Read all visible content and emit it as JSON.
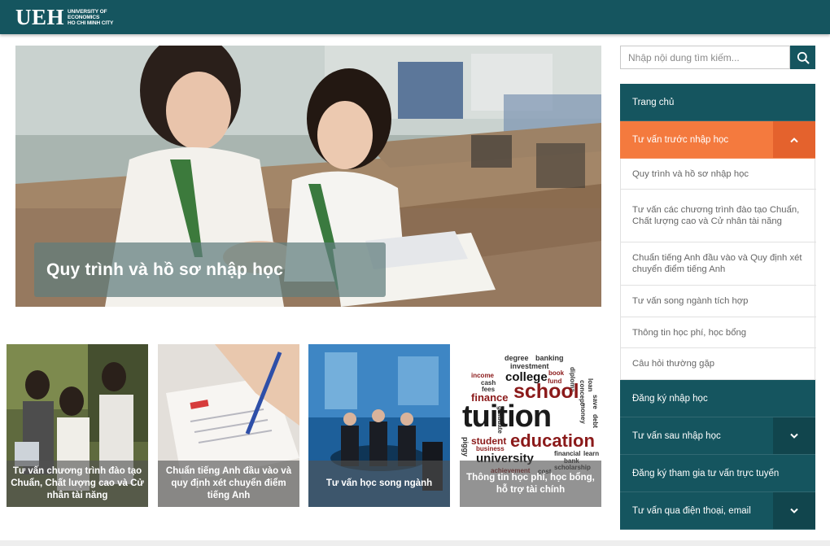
{
  "header": {
    "logo_text": "UEH",
    "logo_sub": [
      "UNIVERSITY OF",
      "ECONOMICS",
      "HO CHI MINH CITY"
    ],
    "bg_color": "#15555f"
  },
  "hero": {
    "caption": "Quy trình và hồ sơ nhập học"
  },
  "thumbnails": [
    {
      "caption": "Tư vấn chương trình đào tạo Chuẩn, Chất lượng cao và Cử nhân tài năng"
    },
    {
      "caption": "Chuẩn tiếng Anh đầu vào và quy định xét chuyển điểm tiếng Anh"
    },
    {
      "caption": "Tư vấn học song ngành"
    },
    {
      "caption": "Thông tin học phí, học bổng, hỗ trợ tài chính"
    }
  ],
  "wordcloud_words": [
    "degree",
    "banking",
    "investment",
    "college",
    "book",
    "fund",
    "diploma",
    "income",
    "cash",
    "fees",
    "finance",
    "school",
    "concept",
    "loan",
    "money",
    "graduate",
    "save",
    "debt",
    "tuition",
    "student",
    "business",
    "education",
    "piggy",
    "financial",
    "learn",
    "university",
    "bank",
    "scholarship",
    "achievement",
    "cost"
  ],
  "search": {
    "placeholder": "Nhập nội dung tìm kiếm...",
    "icon": "search-icon"
  },
  "menu": {
    "items": [
      {
        "label": "Trang chủ"
      },
      {
        "label": "Tư vấn trước nhập học",
        "active": true
      },
      {
        "label": "Đăng ký nhập học"
      },
      {
        "label": "Tư vấn sau nhập học"
      },
      {
        "label": "Đăng ký tham gia tư vấn trực tuyến"
      },
      {
        "label": "Tư vấn qua điện thoại, email"
      }
    ],
    "subitems": [
      {
        "label": "Quy trình và hồ sơ nhập học"
      },
      {
        "label": "Tư vấn các chương trình đào tạo Chuẩn, Chất lượng cao và Cử nhân tài năng"
      },
      {
        "label": "Chuẩn tiếng Anh đầu vào và Quy định xét chuyển điểm tiếng Anh"
      },
      {
        "label": "Tư vấn song ngành tích hợp"
      },
      {
        "label": "Thông tin học phí, học bổng"
      },
      {
        "label": "Câu hỏi thường gặp"
      }
    ],
    "colors": {
      "primary": "#15555f",
      "active": "#f47a3e"
    }
  }
}
